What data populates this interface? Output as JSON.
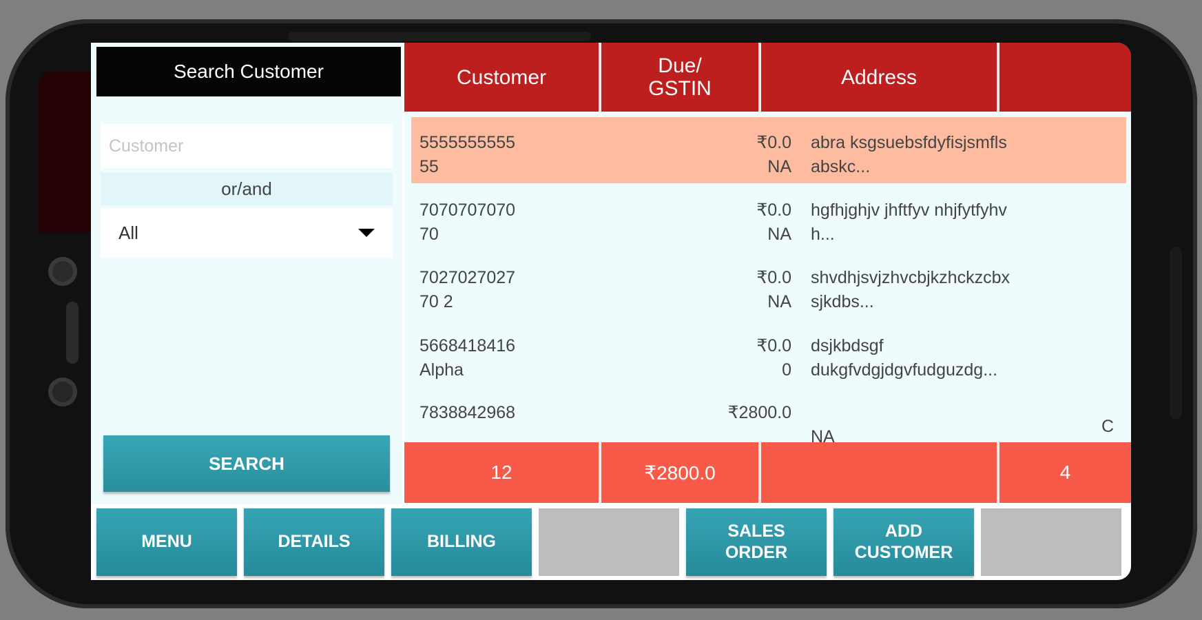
{
  "left_panel": {
    "title": "Search Customer",
    "customer_placeholder": "Customer",
    "or_and": "or/and",
    "filter_value": "All",
    "search_label": "SEARCH"
  },
  "table": {
    "headers": [
      "Customer",
      "Due/\nGSTIN",
      "Address",
      ""
    ],
    "rows": [
      {
        "customer": "5555555555\n55",
        "due": "₹0.0\nNA",
        "address": "abra ksgsuebsfdyfisjsmfls\nabskc...",
        "extra": "",
        "selected": true
      },
      {
        "customer": "7070707070\n70",
        "due": "₹0.0\nNA",
        "address": "hgfhjghjv jhftfyv nhjfytfyhv\nh...",
        "extra": "",
        "selected": false
      },
      {
        "customer": "7027027027\n70 2",
        "due": "₹0.0\nNA",
        "address": "shvdhjsvjzhvcbjkzhckzcbx\nsjkdbs...",
        "extra": "",
        "selected": false
      },
      {
        "customer": "5668418416\nAlpha",
        "due": "₹0.0\n0",
        "address": "dsjkbdsgf\ndukgfvdgjdgvfudguzdg...",
        "extra": "",
        "selected": false
      },
      {
        "customer": "7838842968",
        "due": "₹2800.0",
        "address": "\nNA",
        "extra": "C",
        "selected": false
      }
    ],
    "footer": [
      "12",
      "₹2800.0",
      "",
      "4"
    ]
  },
  "bottom_buttons": [
    "MENU",
    "DETAILS",
    "BILLING",
    "",
    "SALES\nORDER",
    "ADD\nCUSTOMER",
    ""
  ],
  "colors": {
    "header_red": "#bd1f1f",
    "footer_red": "#f85a4a",
    "teal": "#2a8f9e",
    "selected_row": "#fdbca0",
    "panel_bg": "#eefcfe"
  }
}
